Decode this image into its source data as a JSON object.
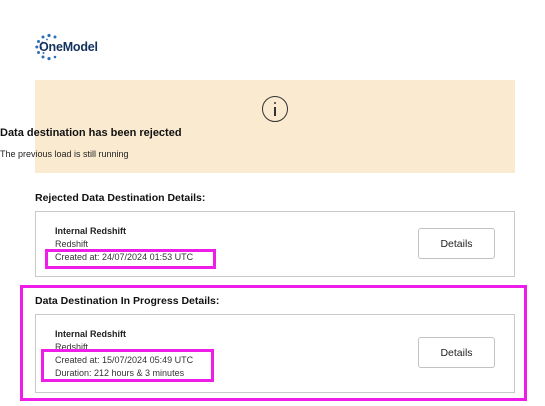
{
  "logo": {
    "text": "OneModel",
    "brand_color": "#13315c"
  },
  "alert": {
    "icon": "info-circle-icon",
    "background": "#faebd0",
    "title": "Data destination has been rejected",
    "subtitle": "The previous load is still running"
  },
  "rejected": {
    "section_title": "Rejected Data Destination Details:",
    "name": "Internal Redshift",
    "type": "Redshift",
    "created": "Created at: 24/07/2024 01:53 UTC",
    "details_label": "Details"
  },
  "in_progress": {
    "section_title": "Data Destination In Progress Details:",
    "name": "Internal Redshift",
    "type": "Redshift",
    "created": "Created at: 15/07/2024 05:49 UTC",
    "duration": "Duration: 212 hours & 3 minutes",
    "details_label": "Details"
  },
  "highlight_color": "#ee1ee8"
}
